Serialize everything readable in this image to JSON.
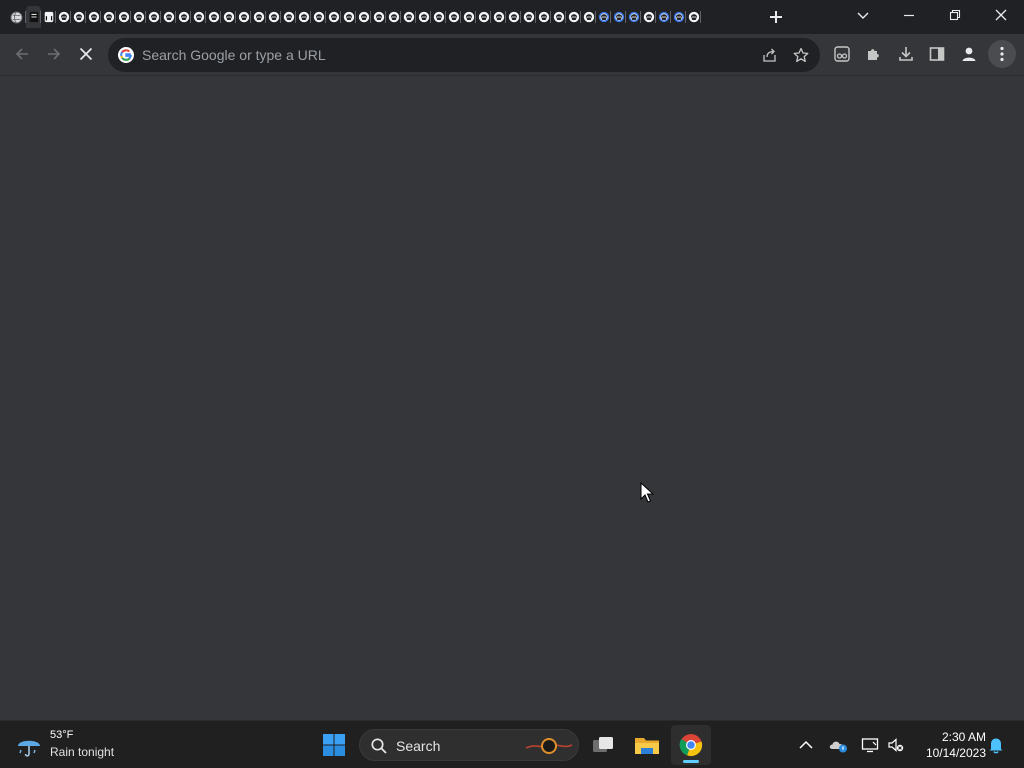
{
  "browser": {
    "tab_count": 46,
    "omnibox": {
      "placeholder": "Search Google or type a URL"
    },
    "loading": true
  },
  "taskbar": {
    "weather": {
      "temperature": "53°F",
      "condition": "Rain tonight"
    },
    "search_label": "Search",
    "apps": [
      "start",
      "search",
      "task-view",
      "file-explorer",
      "chrome"
    ],
    "active_app": "chrome",
    "clock": {
      "time": "2:30 AM",
      "date": "10/14/2023"
    }
  },
  "colors": {
    "frame": "#202124",
    "toolbar": "#35363a",
    "omnibox": "#202124",
    "taskbar": "#202020",
    "accent": "#60cdff",
    "tab_favicon_accent": "#3b78e7"
  }
}
